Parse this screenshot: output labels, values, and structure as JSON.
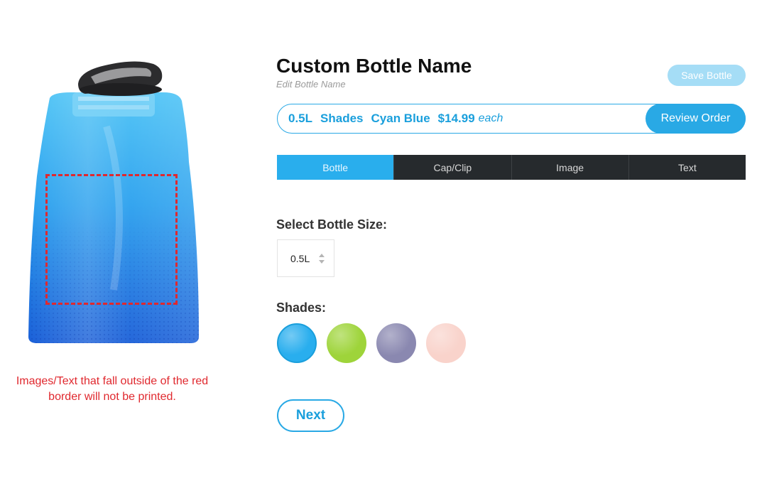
{
  "preview": {
    "print_note": "Images/Text that fall outside of the red border will not be printed."
  },
  "product": {
    "title": "Custom Bottle Name",
    "edit_label": "Edit Bottle Name",
    "save_label": "Save Bottle"
  },
  "summary": {
    "size": "0.5L",
    "shade_group": "Shades",
    "color": "Cyan Blue",
    "price": "$14.99",
    "unit": "each",
    "review_label": "Review Order"
  },
  "tabs": [
    {
      "label": "Bottle",
      "active": true
    },
    {
      "label": "Cap/Clip",
      "active": false
    },
    {
      "label": "Image",
      "active": false
    },
    {
      "label": "Text",
      "active": false
    }
  ],
  "size_select": {
    "label": "Select Bottle Size:",
    "value": "0.5L"
  },
  "shades": {
    "label": "Shades:",
    "swatches": [
      {
        "name": "cyan-blue",
        "color": "#29aeee",
        "selected": true
      },
      {
        "name": "lime-green",
        "color": "#9ed43a",
        "selected": false
      },
      {
        "name": "lavender",
        "color": "#8a88b0",
        "selected": false
      },
      {
        "name": "blush-pink",
        "color": "#f9d3cb",
        "selected": false
      }
    ]
  },
  "next_label": "Next",
  "colors": {
    "accent": "#29a9e5",
    "dark_tab": "#262a2d",
    "warning": "#e0282e"
  }
}
